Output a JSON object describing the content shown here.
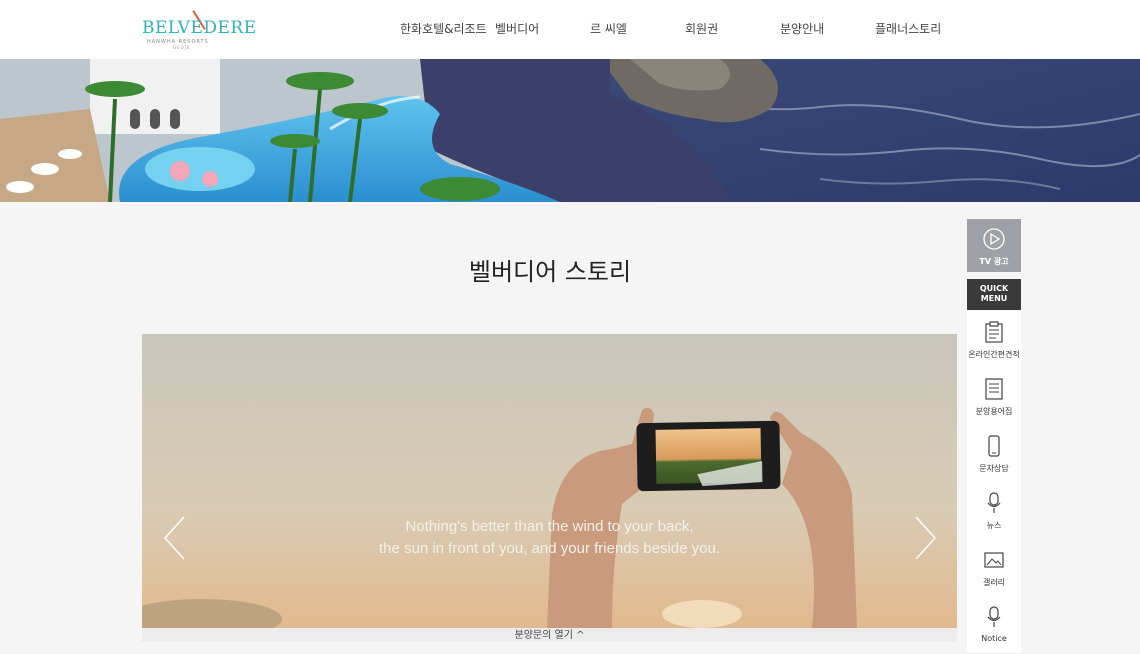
{
  "header": {
    "logo": {
      "name": "BELVEDERE",
      "sub": "HANWHA RESORTS",
      "sub2": "GEOJE"
    },
    "nav": [
      "한화호텔&리조트",
      "벨버디어",
      "르 씨엘",
      "회원권",
      "분양안내",
      "플래너스토리"
    ]
  },
  "page_title": "벨버디어 스토리",
  "slider": {
    "quote_line1": "Nothing's better than the wind to your back,",
    "quote_line2": "the sun in front of you, and your friends beside you.",
    "consult_label": "분양문의 열기 ^"
  },
  "side": {
    "tv_label": "TV 광고",
    "quick_line1": "QUICK",
    "quick_line2": "MENU",
    "items": [
      "온라인간편견적",
      "분양용어집",
      "문자상담",
      "뉴스",
      "갤러리",
      "Notice"
    ]
  },
  "colors": {
    "brand": "#2fb3b3",
    "accent": "#e85a3c",
    "tv_bg": "#a0a1a6",
    "quick_bg": "#3a3a3a"
  }
}
